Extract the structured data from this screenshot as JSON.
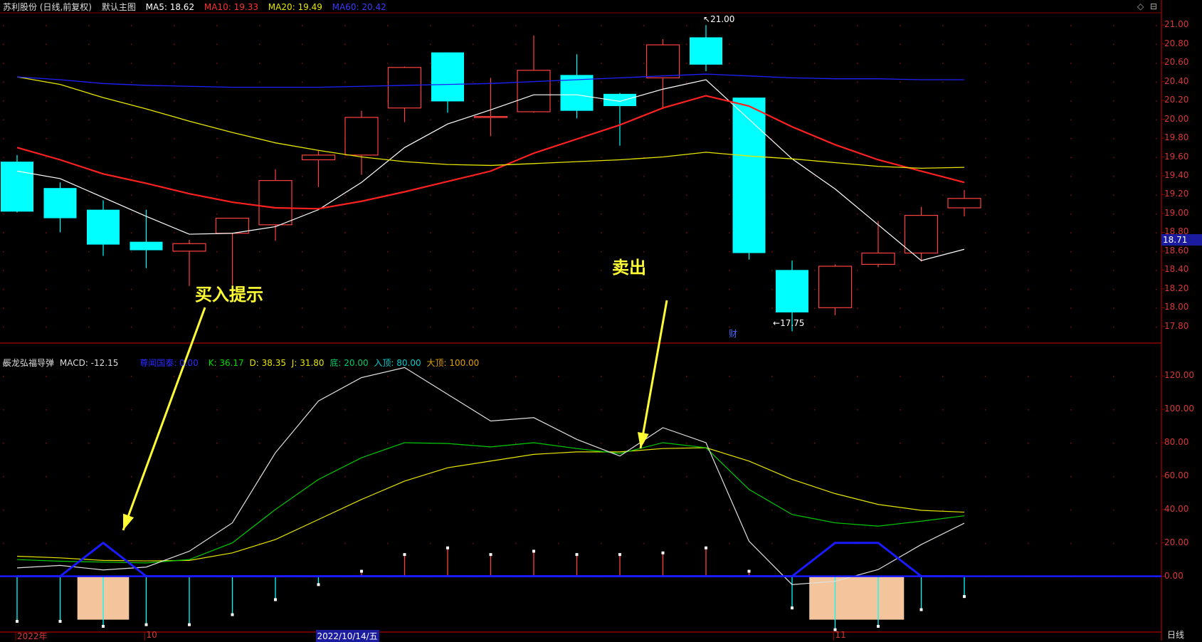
{
  "main_header": {
    "title": "苏利股份 (日线,前复权)",
    "template": "默认主图",
    "ma5": "MA5: 18.62",
    "ma10": "MA10: 19.33",
    "ma20": "MA20: 19.49",
    "ma60": "MA60: 20.42"
  },
  "sub_header": {
    "title": "辰龙弘福导弹",
    "macd": "MACD: -12.15",
    "hint": "尊闻国泰: 0.00",
    "k": "K: 36.17",
    "d": "D: 38.35",
    "j": "J: 31.80",
    "di": "底: 20.00",
    "ru": "入顶: 80.00",
    "da": "大顶: 100.00"
  },
  "annotations": {
    "buy": "买入提示",
    "sell": "卖出"
  },
  "markers": {
    "high": "21.00",
    "low": "17.75",
    "cai": "财",
    "current_price": "18.71"
  },
  "period": "日线",
  "colors": {
    "up": "#ff4040",
    "down": "#00ffff",
    "ma5": "#ffffff",
    "ma10": "#ff2020",
    "ma20": "#e6e600",
    "ma60": "#2020ff",
    "k": "#e0e0e0",
    "d": "#00cc00",
    "j": "#e6e600",
    "signal": "#1a1aff",
    "zone": "#f4c49c",
    "grid": "#8b0000",
    "axis_text": "#d83838"
  },
  "chart_data": [
    {
      "type": "candlestick",
      "title": "苏利股份 (日线,前复权)",
      "ylim": [
        17.7,
        21.1
      ],
      "yticks": [
        "21.00",
        "20.80",
        "20.60",
        "20.40",
        "20.20",
        "20.00",
        "19.80",
        "19.60",
        "19.40",
        "19.20",
        "19.00",
        "18.80",
        "18.60",
        "18.40",
        "18.20",
        "18.00",
        "17.80"
      ],
      "x_labels": [
        {
          "index": 0,
          "label": "2022年"
        },
        {
          "index": 3,
          "label": "10"
        },
        {
          "index": 7,
          "label": "2022/10/14/五"
        },
        {
          "index": 19,
          "label": "11"
        }
      ],
      "candles": [
        {
          "o": 19.55,
          "h": 19.62,
          "l": 19.01,
          "c": 19.02
        },
        {
          "o": 19.27,
          "h": 19.33,
          "l": 18.8,
          "c": 18.95
        },
        {
          "o": 19.04,
          "h": 19.14,
          "l": 18.55,
          "c": 18.67
        },
        {
          "o": 18.7,
          "h": 19.04,
          "l": 18.42,
          "c": 18.61
        },
        {
          "o": 18.6,
          "h": 18.72,
          "l": 18.23,
          "c": 18.68
        },
        {
          "o": 18.79,
          "h": 18.95,
          "l": 18.24,
          "c": 18.95
        },
        {
          "o": 18.88,
          "h": 19.47,
          "l": 18.71,
          "c": 19.35
        },
        {
          "o": 19.57,
          "h": 19.67,
          "l": 19.28,
          "c": 19.62
        },
        {
          "o": 19.62,
          "h": 20.09,
          "l": 19.41,
          "c": 20.02
        },
        {
          "o": 20.12,
          "h": 20.56,
          "l": 19.97,
          "c": 20.55
        },
        {
          "o": 20.71,
          "h": 20.71,
          "l": 20.07,
          "c": 20.19
        },
        {
          "o": 20.03,
          "h": 20.44,
          "l": 19.82,
          "c": 20.03
        },
        {
          "o": 20.08,
          "h": 20.89,
          "l": 20.07,
          "c": 20.52
        },
        {
          "o": 20.47,
          "h": 20.69,
          "l": 20.01,
          "c": 20.09
        },
        {
          "o": 20.27,
          "h": 20.28,
          "l": 19.72,
          "c": 20.14
        },
        {
          "o": 20.44,
          "h": 20.85,
          "l": 20.11,
          "c": 20.79
        },
        {
          "o": 20.87,
          "h": 21.0,
          "l": 20.51,
          "c": 20.58
        },
        {
          "o": 20.23,
          "h": 20.23,
          "l": 18.51,
          "c": 18.58
        },
        {
          "o": 18.4,
          "h": 18.5,
          "l": 17.75,
          "c": 17.95
        },
        {
          "o": 18.0,
          "h": 18.46,
          "l": 17.92,
          "c": 18.44
        },
        {
          "o": 18.46,
          "h": 18.92,
          "l": 18.43,
          "c": 18.58
        },
        {
          "o": 18.58,
          "h": 19.07,
          "l": 18.49,
          "c": 18.98
        },
        {
          "o": 19.06,
          "h": 19.25,
          "l": 18.97,
          "c": 19.16
        }
      ],
      "series": [
        {
          "name": "MA5",
          "values": [
            19.45,
            19.37,
            19.17,
            18.97,
            18.78,
            18.79,
            18.86,
            19.04,
            19.33,
            19.7,
            19.95,
            20.1,
            20.26,
            20.26,
            20.19,
            20.32,
            20.42,
            20.0,
            19.58,
            19.26,
            18.88,
            18.5,
            18.62
          ]
        },
        {
          "name": "MA10",
          "values": [
            19.7,
            19.57,
            19.42,
            19.32,
            19.21,
            19.12,
            19.06,
            19.05,
            19.13,
            19.23,
            19.34,
            19.45,
            19.64,
            19.79,
            19.94,
            20.12,
            20.25,
            20.14,
            19.92,
            19.73,
            19.57,
            19.45,
            19.33
          ]
        },
        {
          "name": "MA20",
          "values": [
            20.45,
            20.37,
            20.23,
            20.11,
            19.98,
            19.86,
            19.75,
            19.67,
            19.6,
            19.55,
            19.52,
            19.51,
            19.53,
            19.55,
            19.57,
            19.6,
            19.65,
            19.61,
            19.58,
            19.54,
            19.5,
            19.48,
            19.49
          ]
        },
        {
          "name": "MA60",
          "values": [
            20.45,
            20.42,
            20.38,
            20.36,
            20.35,
            20.34,
            20.34,
            20.34,
            20.35,
            20.36,
            20.37,
            20.38,
            20.4,
            20.42,
            20.44,
            20.46,
            20.48,
            20.46,
            20.44,
            20.43,
            20.43,
            20.42,
            20.42
          ]
        }
      ]
    },
    {
      "type": "line",
      "title": "辰龙弘福导弹",
      "ylim": [
        -30,
        132
      ],
      "yticks": [
        "120.00",
        "100.00",
        "80.00",
        "60.00",
        "40.00",
        "20.00",
        "0.00"
      ],
      "series": [
        {
          "name": "K",
          "values": [
            5.0,
            6.5,
            3.8,
            5.5,
            15.0,
            32.0,
            74.0,
            105.0,
            119.0,
            125.0,
            109.0,
            93.0,
            95.0,
            82.0,
            72.0,
            89.0,
            80.0,
            21.0,
            -5.0,
            -3.0,
            4.0,
            19.0,
            31.8
          ]
        },
        {
          "name": "D",
          "values": [
            10.0,
            9.0,
            8.5,
            8.0,
            10.0,
            20.0,
            40.0,
            58.0,
            71.0,
            80.0,
            79.5,
            77.5,
            80.0,
            76.5,
            73.5,
            80.0,
            77.0,
            52.0,
            37.0,
            32.0,
            30.0,
            33.0,
            36.2
          ]
        },
        {
          "name": "J",
          "values": [
            12.0,
            11.0,
            9.5,
            9.2,
            9.5,
            14.0,
            22.0,
            34.0,
            46.0,
            57.0,
            65.0,
            69.0,
            73.0,
            74.5,
            74.5,
            76.5,
            77.0,
            69.0,
            58.0,
            49.5,
            43.0,
            39.5,
            38.4
          ]
        },
        {
          "name": "尊闻国泰",
          "values": [
            0,
            0,
            20,
            0,
            0,
            0,
            0,
            0,
            0,
            0,
            0,
            0,
            0,
            0,
            0,
            0,
            0,
            0,
            0,
            20,
            20,
            0,
            0
          ]
        },
        {
          "name": "MACD",
          "values": [
            -27,
            -27,
            -30,
            -29,
            -29,
            -23,
            -14,
            -5,
            3,
            13,
            17,
            13,
            15,
            13,
            13,
            14,
            17,
            3,
            -19,
            -32,
            -30,
            -20,
            -12.15
          ]
        }
      ],
      "zones": [
        {
          "from": 1.4,
          "to": 2.6
        },
        {
          "from": 18.4,
          "to": 20.6
        }
      ]
    }
  ]
}
